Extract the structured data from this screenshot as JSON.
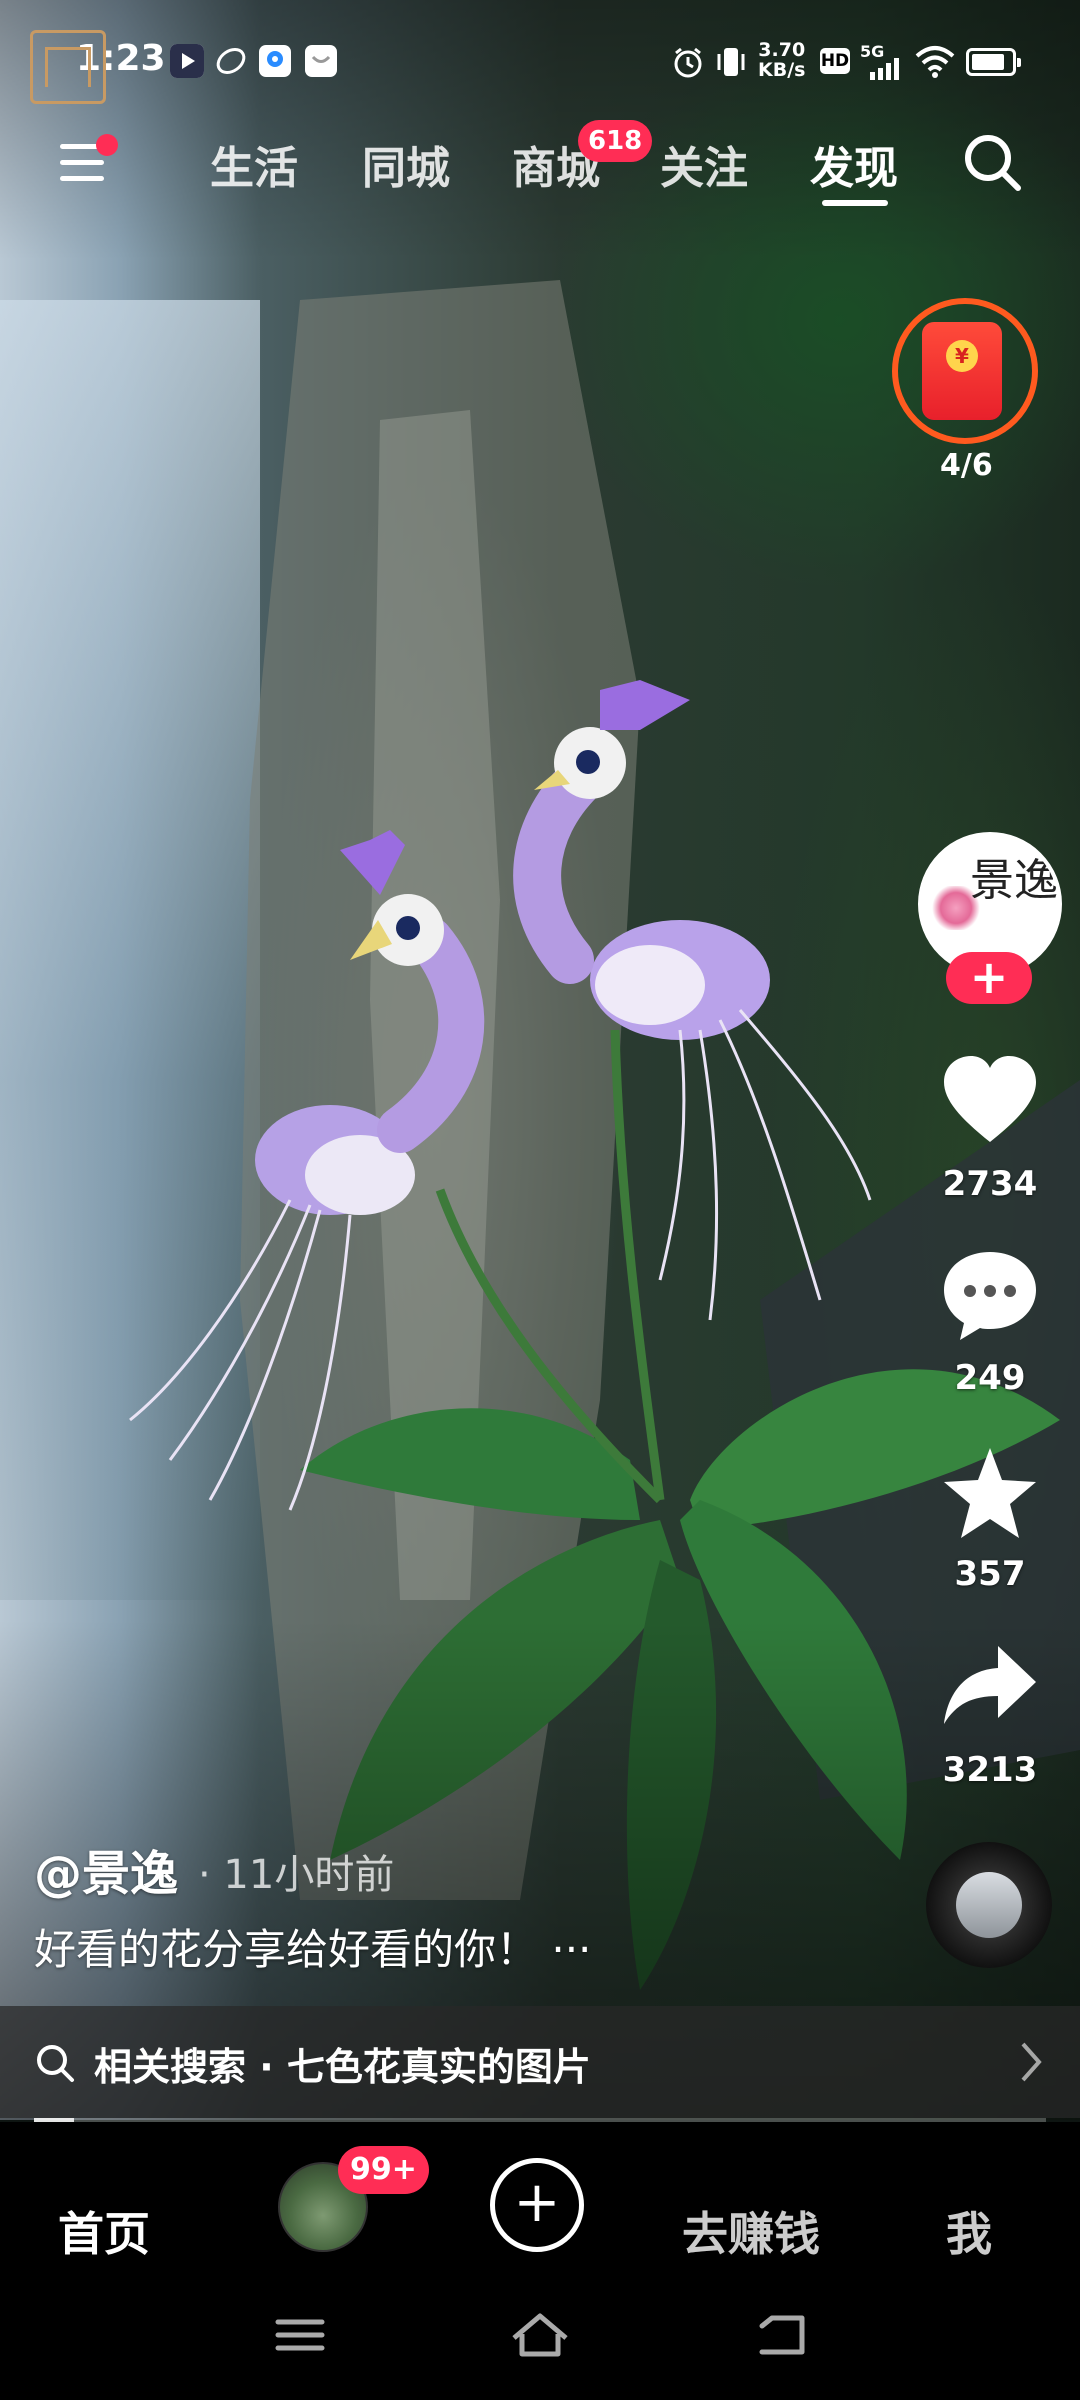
{
  "status_bar": {
    "time": "1:23",
    "net_speed_value": "3.70",
    "net_speed_unit": "KB/s",
    "hd": "HD",
    "network": "5G",
    "battery_level": 0.85
  },
  "top_nav": {
    "tabs": [
      {
        "label": "生活"
      },
      {
        "label": "同城"
      },
      {
        "label": "商城"
      },
      {
        "label": "关注"
      },
      {
        "label": "发现"
      }
    ],
    "active_tab": "发现",
    "mall_badge": "618"
  },
  "red_packet": {
    "progress": "4/6"
  },
  "actions": {
    "avatar_text": "景逸",
    "like_count": "2734",
    "comment_count": "249",
    "favorite_count": "357",
    "share_count": "3213"
  },
  "post": {
    "author": "@景逸",
    "time": "· 11小时前",
    "caption": "好看的花分享给好看的你！ ···"
  },
  "related_search": {
    "text": "相关搜索 · 七色花真实的图片"
  },
  "video_progress": 0.04,
  "bottom_tabs": {
    "home": "首页",
    "friends_badge": "99+",
    "earn": "去赚钱",
    "me": "我"
  },
  "colors": {
    "accent_red": "#ff2d55",
    "ring_orange": "#ff5a1f"
  }
}
